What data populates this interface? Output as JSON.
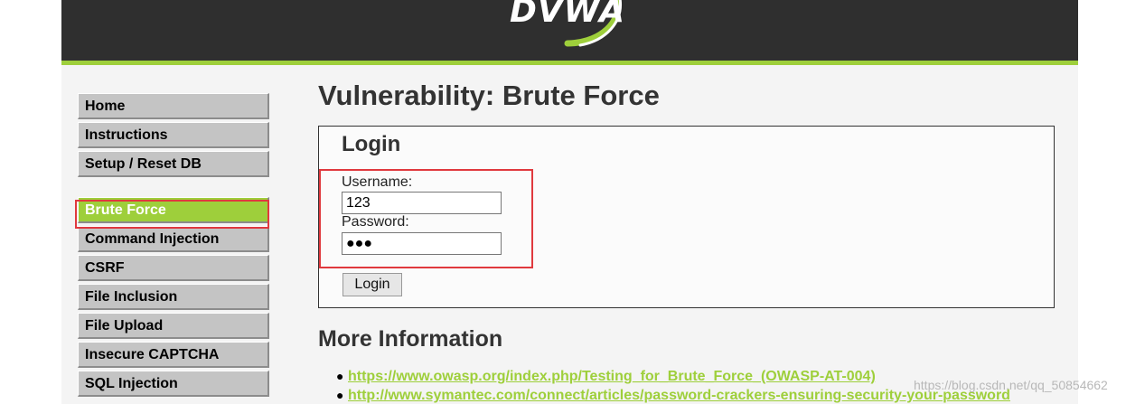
{
  "header": {
    "logo_text": "DVWA"
  },
  "menu": {
    "group1": [
      {
        "label": "Home"
      },
      {
        "label": "Instructions"
      },
      {
        "label": "Setup / Reset DB"
      }
    ],
    "group2": [
      {
        "label": "Brute Force",
        "active": true
      },
      {
        "label": "Command Injection"
      },
      {
        "label": "CSRF"
      },
      {
        "label": "File Inclusion"
      },
      {
        "label": "File Upload"
      },
      {
        "label": "Insecure CAPTCHA"
      },
      {
        "label": "SQL Injection"
      }
    ]
  },
  "main": {
    "title": "Vulnerability: Brute Force",
    "login": {
      "heading": "Login",
      "username_label": "Username:",
      "username_value": "123",
      "password_label": "Password:",
      "password_value": "●●●",
      "button_label": "Login"
    },
    "more_info": {
      "heading": "More Information",
      "links": [
        "https://www.owasp.org/index.php/Testing_for_Brute_Force_(OWASP-AT-004)",
        "http://www.symantec.com/connect/articles/password-crackers-ensuring-security-your-password"
      ]
    }
  },
  "watermark": "https://blog.csdn.net/qq_50854662",
  "colors": {
    "accent": "#9ecf3b",
    "header_bg": "#2f2f2f",
    "highlight": "#e0393e"
  }
}
